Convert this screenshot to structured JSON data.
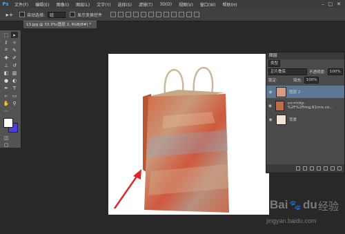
{
  "app": {
    "logo": "Ps"
  },
  "menu": [
    "文件(F)",
    "编辑(E)",
    "图像(I)",
    "图层(L)",
    "文字(Y)",
    "选择(S)",
    "滤镜(T)",
    "3D(D)",
    "视图(V)",
    "窗口(W)",
    "帮助(H)"
  ],
  "window_controls": [
    "–",
    "□",
    "✕"
  ],
  "options": {
    "auto_select": "自动选择:",
    "group_value": "组",
    "show_transform": "显示变换控件"
  },
  "document": {
    "tab": "13.jpg @ 33.3%(图层 2, RGB/8#) *"
  },
  "layers_panel": {
    "title": "图层",
    "kind": "类型",
    "blend_mode": "正片叠底",
    "opacity_label": "不透明度:",
    "opacity": "100%",
    "lock_label": "锁定:",
    "fill_label": "填充:",
    "fill": "100%",
    "layers": [
      {
        "name": "图层 2"
      },
      {
        "name": "src=http-%2F%2Fimg.61mix.co..."
      },
      {
        "name": "背景"
      }
    ]
  },
  "watermark": {
    "brand": "Bai",
    "brand2": "du",
    "jingyan": "经验",
    "url": "jingyan.baidu.com"
  },
  "colors": {
    "accent": "#31a8ff",
    "bg_color_swatch": "#4b3fe0",
    "arrow": "#e0262b"
  }
}
